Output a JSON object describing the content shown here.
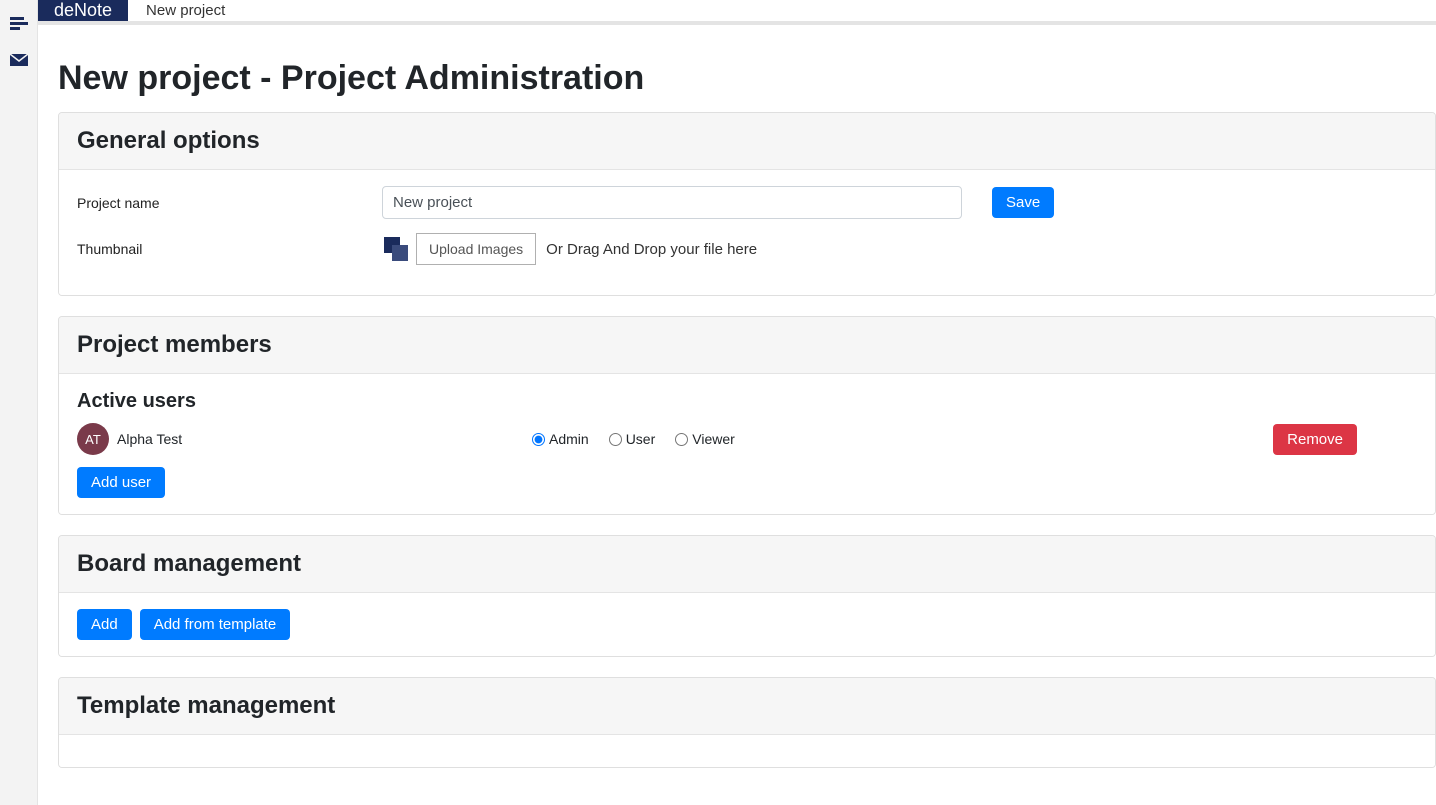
{
  "brand": "deNote",
  "breadcrumb": "New project",
  "page_title": "New project - Project Administration",
  "general": {
    "heading": "General options",
    "project_name_label": "Project name",
    "project_name_value": "New project",
    "save_label": "Save",
    "thumbnail_label": "Thumbnail",
    "upload_label": "Upload Images",
    "drag_text": "Or Drag And Drop your file here"
  },
  "members": {
    "heading": "Project members",
    "active_heading": "Active users",
    "user": {
      "initials": "AT",
      "name": "Alpha Test",
      "roles": {
        "admin": "Admin",
        "user": "User",
        "viewer": "Viewer"
      },
      "selected_role": "admin"
    },
    "remove_label": "Remove",
    "add_user_label": "Add user"
  },
  "boards": {
    "heading": "Board management",
    "add_label": "Add",
    "add_template_label": "Add from template"
  },
  "templates": {
    "heading": "Template management"
  }
}
